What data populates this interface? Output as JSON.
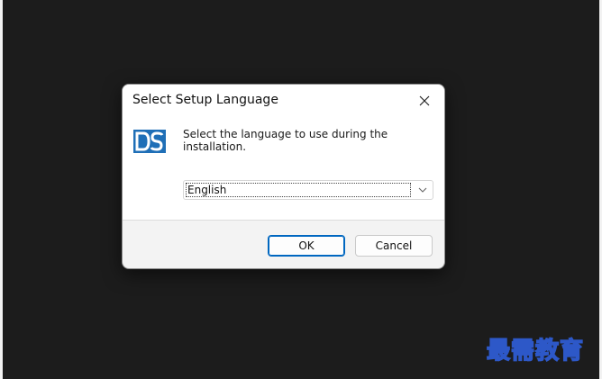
{
  "dialog": {
    "title": "Select Setup Language",
    "message": "Select the language to use during the installation.",
    "language_select": {
      "selected": "English"
    },
    "ok_label": "OK",
    "cancel_label": "Cancel"
  },
  "icons": {
    "close": "close-icon",
    "logo": "ds-logo-icon",
    "dropdown": "chevron-down-icon"
  },
  "watermark": {
    "text": "最需教育"
  },
  "colors": {
    "background": "#1c1c1c",
    "dialog": "#f3f3f3",
    "accent": "#0067c0",
    "logo": "#1f6fb7",
    "watermark_stroke": "#2d58c8"
  }
}
